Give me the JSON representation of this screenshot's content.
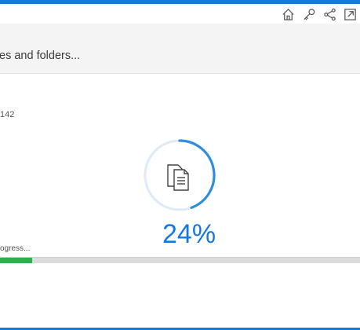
{
  "colors": {
    "accent": "#1479d9",
    "ring_track": "#dcebf7",
    "ring_arc": "#2e8ddf",
    "progress_green": "#2db14a"
  },
  "toolbar": {
    "icons": [
      "home-icon",
      "key-icon",
      "share-icon",
      "export-icon"
    ]
  },
  "header": {
    "status_text": "es and folders..."
  },
  "scan": {
    "file_count": "142",
    "percent_text": "24%",
    "progress_label": "ogress...",
    "progress": 0.24
  }
}
